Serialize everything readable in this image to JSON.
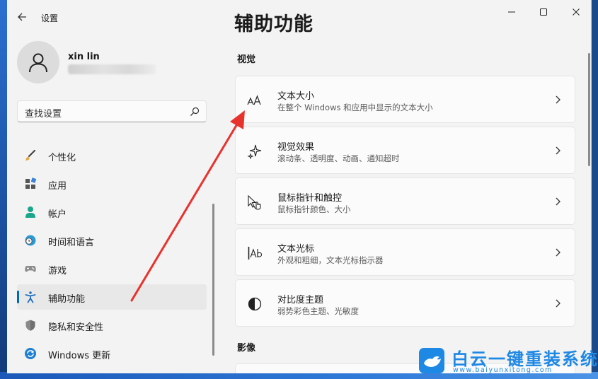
{
  "window": {
    "app_title": "设置",
    "page_title": "辅助功能"
  },
  "user": {
    "name": "xin lin"
  },
  "search": {
    "placeholder": "查找设置"
  },
  "sidebar": {
    "items": [
      {
        "label": "个性化",
        "icon": "paintbrush-icon",
        "active": false
      },
      {
        "label": "应用",
        "icon": "apps-icon",
        "active": false
      },
      {
        "label": "帐户",
        "icon": "account-icon",
        "active": false
      },
      {
        "label": "时间和语言",
        "icon": "globe-clock-icon",
        "active": false
      },
      {
        "label": "游戏",
        "icon": "gamepad-icon",
        "active": false
      },
      {
        "label": "辅助功能",
        "icon": "accessibility-icon",
        "active": true
      },
      {
        "label": "隐私和安全性",
        "icon": "shield-icon",
        "active": false
      },
      {
        "label": "Windows 更新",
        "icon": "windows-update-icon",
        "active": false
      }
    ]
  },
  "main": {
    "sections": [
      {
        "title": "视觉"
      },
      {
        "title": "影像"
      }
    ],
    "cards": [
      {
        "title": "文本大小",
        "desc": "在整个 Windows 和应用中显示的文本大小",
        "icon": "text-size-icon"
      },
      {
        "title": "视觉效果",
        "desc": "滚动条、透明度、动画、通知超时",
        "icon": "sparkle-icon"
      },
      {
        "title": "鼠标指针和触控",
        "desc": "鼠标指针颜色、大小",
        "icon": "mouse-pointer-icon"
      },
      {
        "title": "文本光标",
        "desc": "外观和粗细，文本光标指示器",
        "icon": "text-cursor-icon"
      },
      {
        "title": "对比度主题",
        "desc": "弱势彩色主题、光敏度",
        "icon": "contrast-icon"
      }
    ]
  },
  "watermark": {
    "title": "白云一键重装系统",
    "url": "www.baiyunxitong.com"
  },
  "colors": {
    "accent": "#0067c0",
    "annotation_arrow": "#e8322d",
    "watermark": "#1e88e5"
  }
}
